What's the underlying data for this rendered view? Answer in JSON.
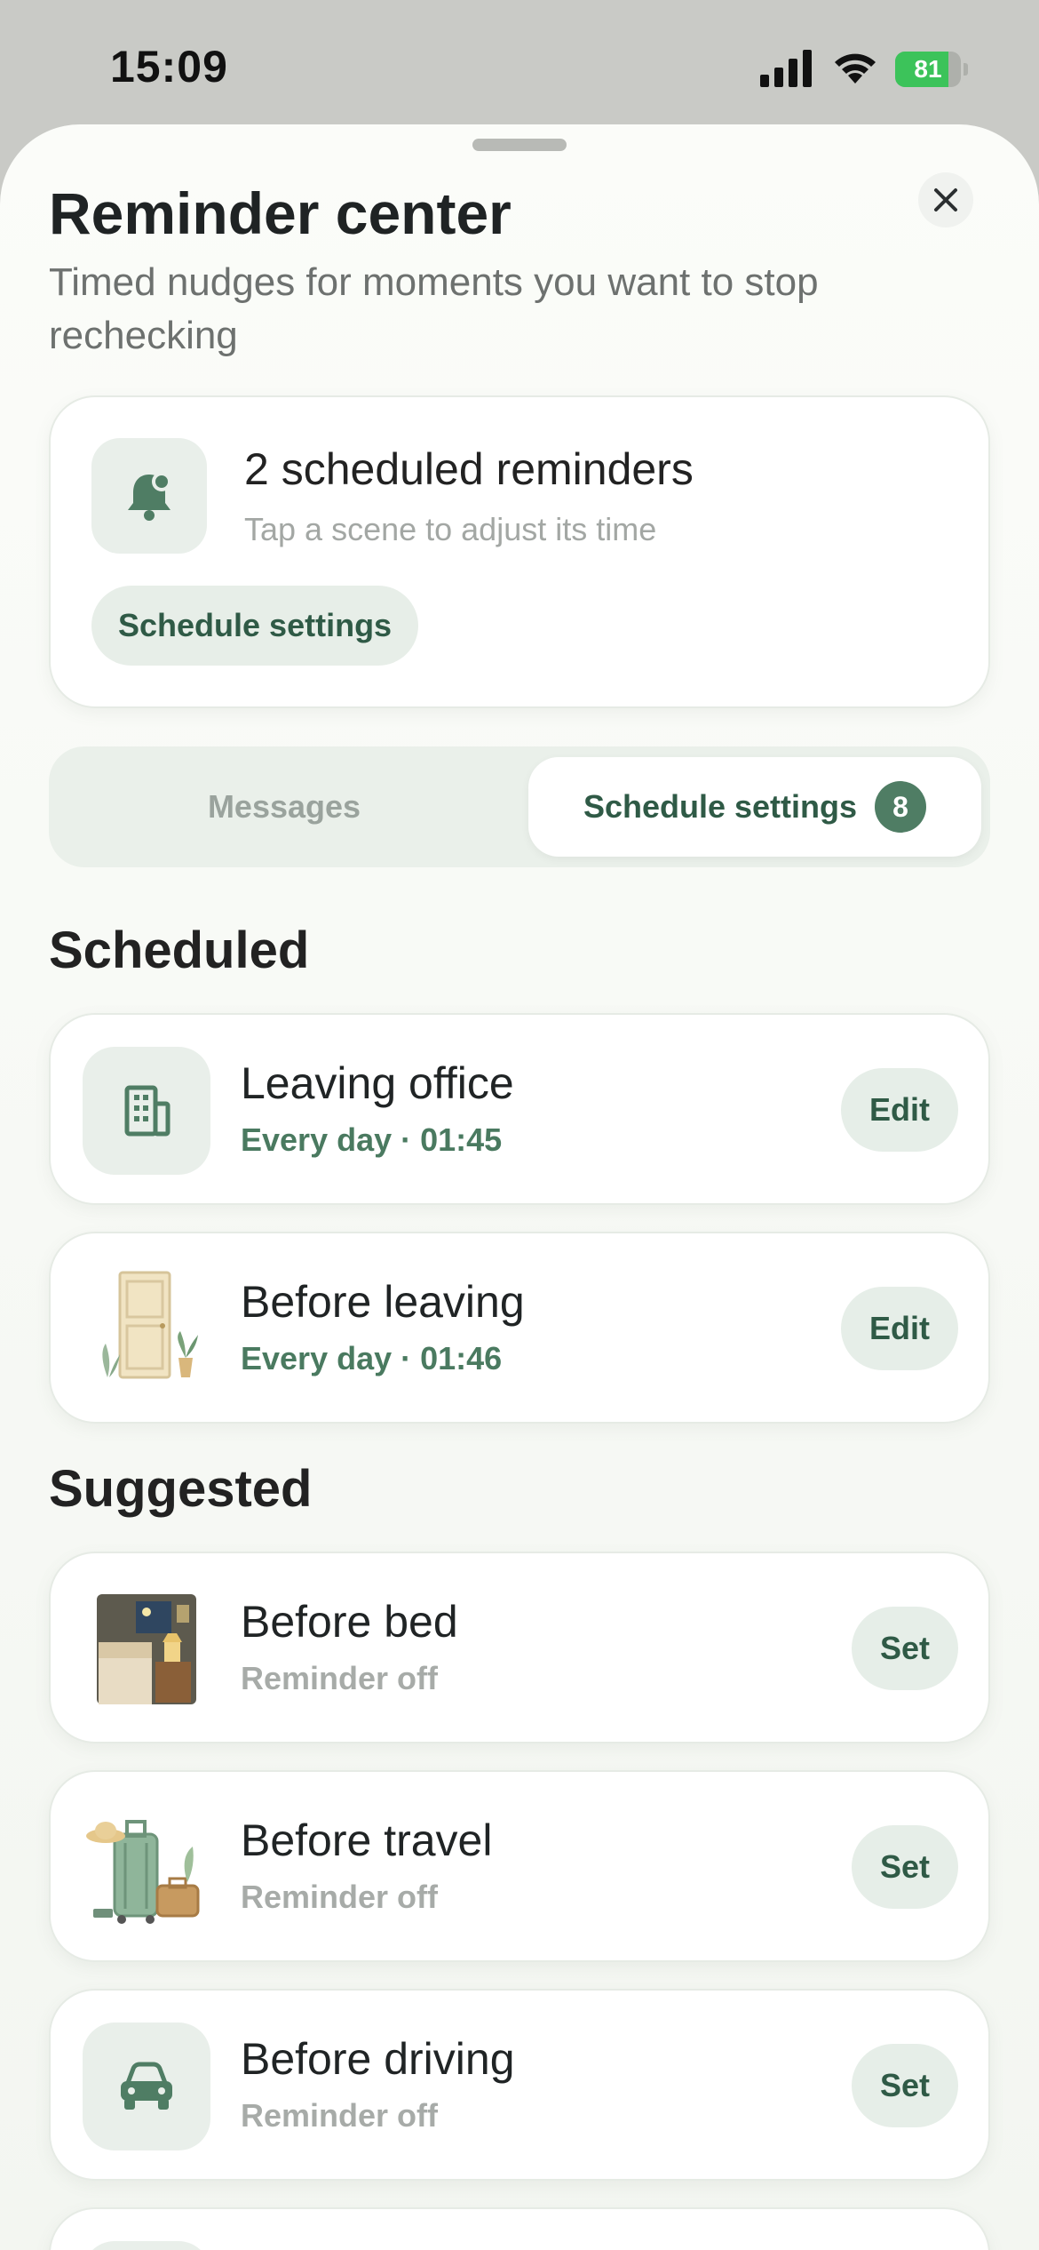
{
  "status_bar": {
    "time": "15:09",
    "battery_level": "81",
    "battery_fraction": 0.81
  },
  "header": {
    "title": "Reminder center",
    "subtitle": "Timed nudges for moments you want to stop rechecking"
  },
  "summary": {
    "title": "2 scheduled reminders",
    "hint": "Tap a scene to adjust its time",
    "button": "Schedule settings",
    "icon": "bell-icon"
  },
  "tabs": {
    "messages": "Messages",
    "schedule": "Schedule settings",
    "schedule_badge": "8",
    "active": "schedule"
  },
  "scheduled": {
    "title": "Scheduled",
    "items": [
      {
        "title": "Leaving office",
        "sub": "Every day · 01:45",
        "button": "Edit",
        "icon": "office-building-icon"
      },
      {
        "title": "Before leaving",
        "sub": "Every day · 01:46",
        "button": "Edit",
        "icon": "door-plant-illustration"
      }
    ]
  },
  "suggested": {
    "title": "Suggested",
    "items": [
      {
        "title": "Before bed",
        "sub": "Reminder off",
        "button": "Set",
        "icon": "bedroom-illustration"
      },
      {
        "title": "Before travel",
        "sub": "Reminder off",
        "button": "Set",
        "icon": "suitcase-illustration"
      },
      {
        "title": "Before driving",
        "sub": "Reminder off",
        "button": "Set",
        "icon": "car-icon"
      }
    ]
  },
  "colors": {
    "accent": "#4f7d64",
    "accent_dark": "#2f5a46",
    "pill_bg": "#e6eee8",
    "battery_green": "#3cc35a"
  }
}
